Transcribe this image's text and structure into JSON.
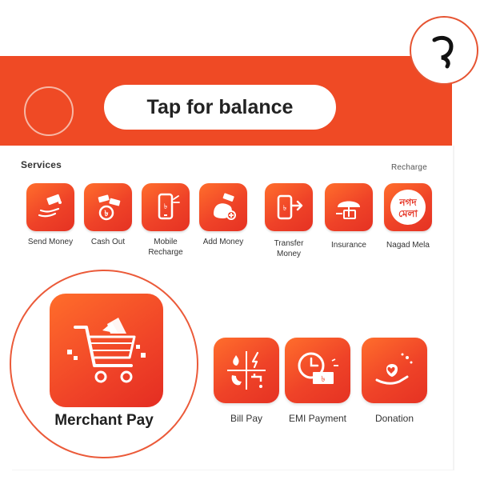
{
  "header": {
    "balance_button": "Tap for balance"
  },
  "badge": {
    "digit": "১"
  },
  "services": {
    "title": "Services",
    "top_clipped_label": "Recharge",
    "row1": [
      {
        "label": "Send Money",
        "icon": "send-money-icon"
      },
      {
        "label": "Cash Out",
        "icon": "cash-out-icon"
      },
      {
        "label": "Mobile Recharge",
        "icon": "mobile-recharge-icon"
      },
      {
        "label": "Add Money",
        "icon": "add-money-icon"
      },
      {
        "label": "Transfer Money",
        "icon": "transfer-money-icon"
      },
      {
        "label": "Insurance",
        "icon": "insurance-icon"
      },
      {
        "label": "Nagad Mela",
        "icon": "nagad-mela-icon",
        "badge_line1": "নগদ",
        "badge_line2": "মেলা"
      }
    ],
    "row2": [
      {
        "label": "Merchant Pay",
        "icon": "shopping-cart-icon"
      },
      {
        "label": "Bill Pay",
        "icon": "bill-pay-icon"
      },
      {
        "label": "EMI Payment",
        "icon": "emi-payment-icon"
      },
      {
        "label": "Donation",
        "icon": "donation-icon"
      }
    ]
  },
  "colors": {
    "brand": "#ef4a25",
    "accent": "#e53223",
    "background": "#ffffff"
  }
}
